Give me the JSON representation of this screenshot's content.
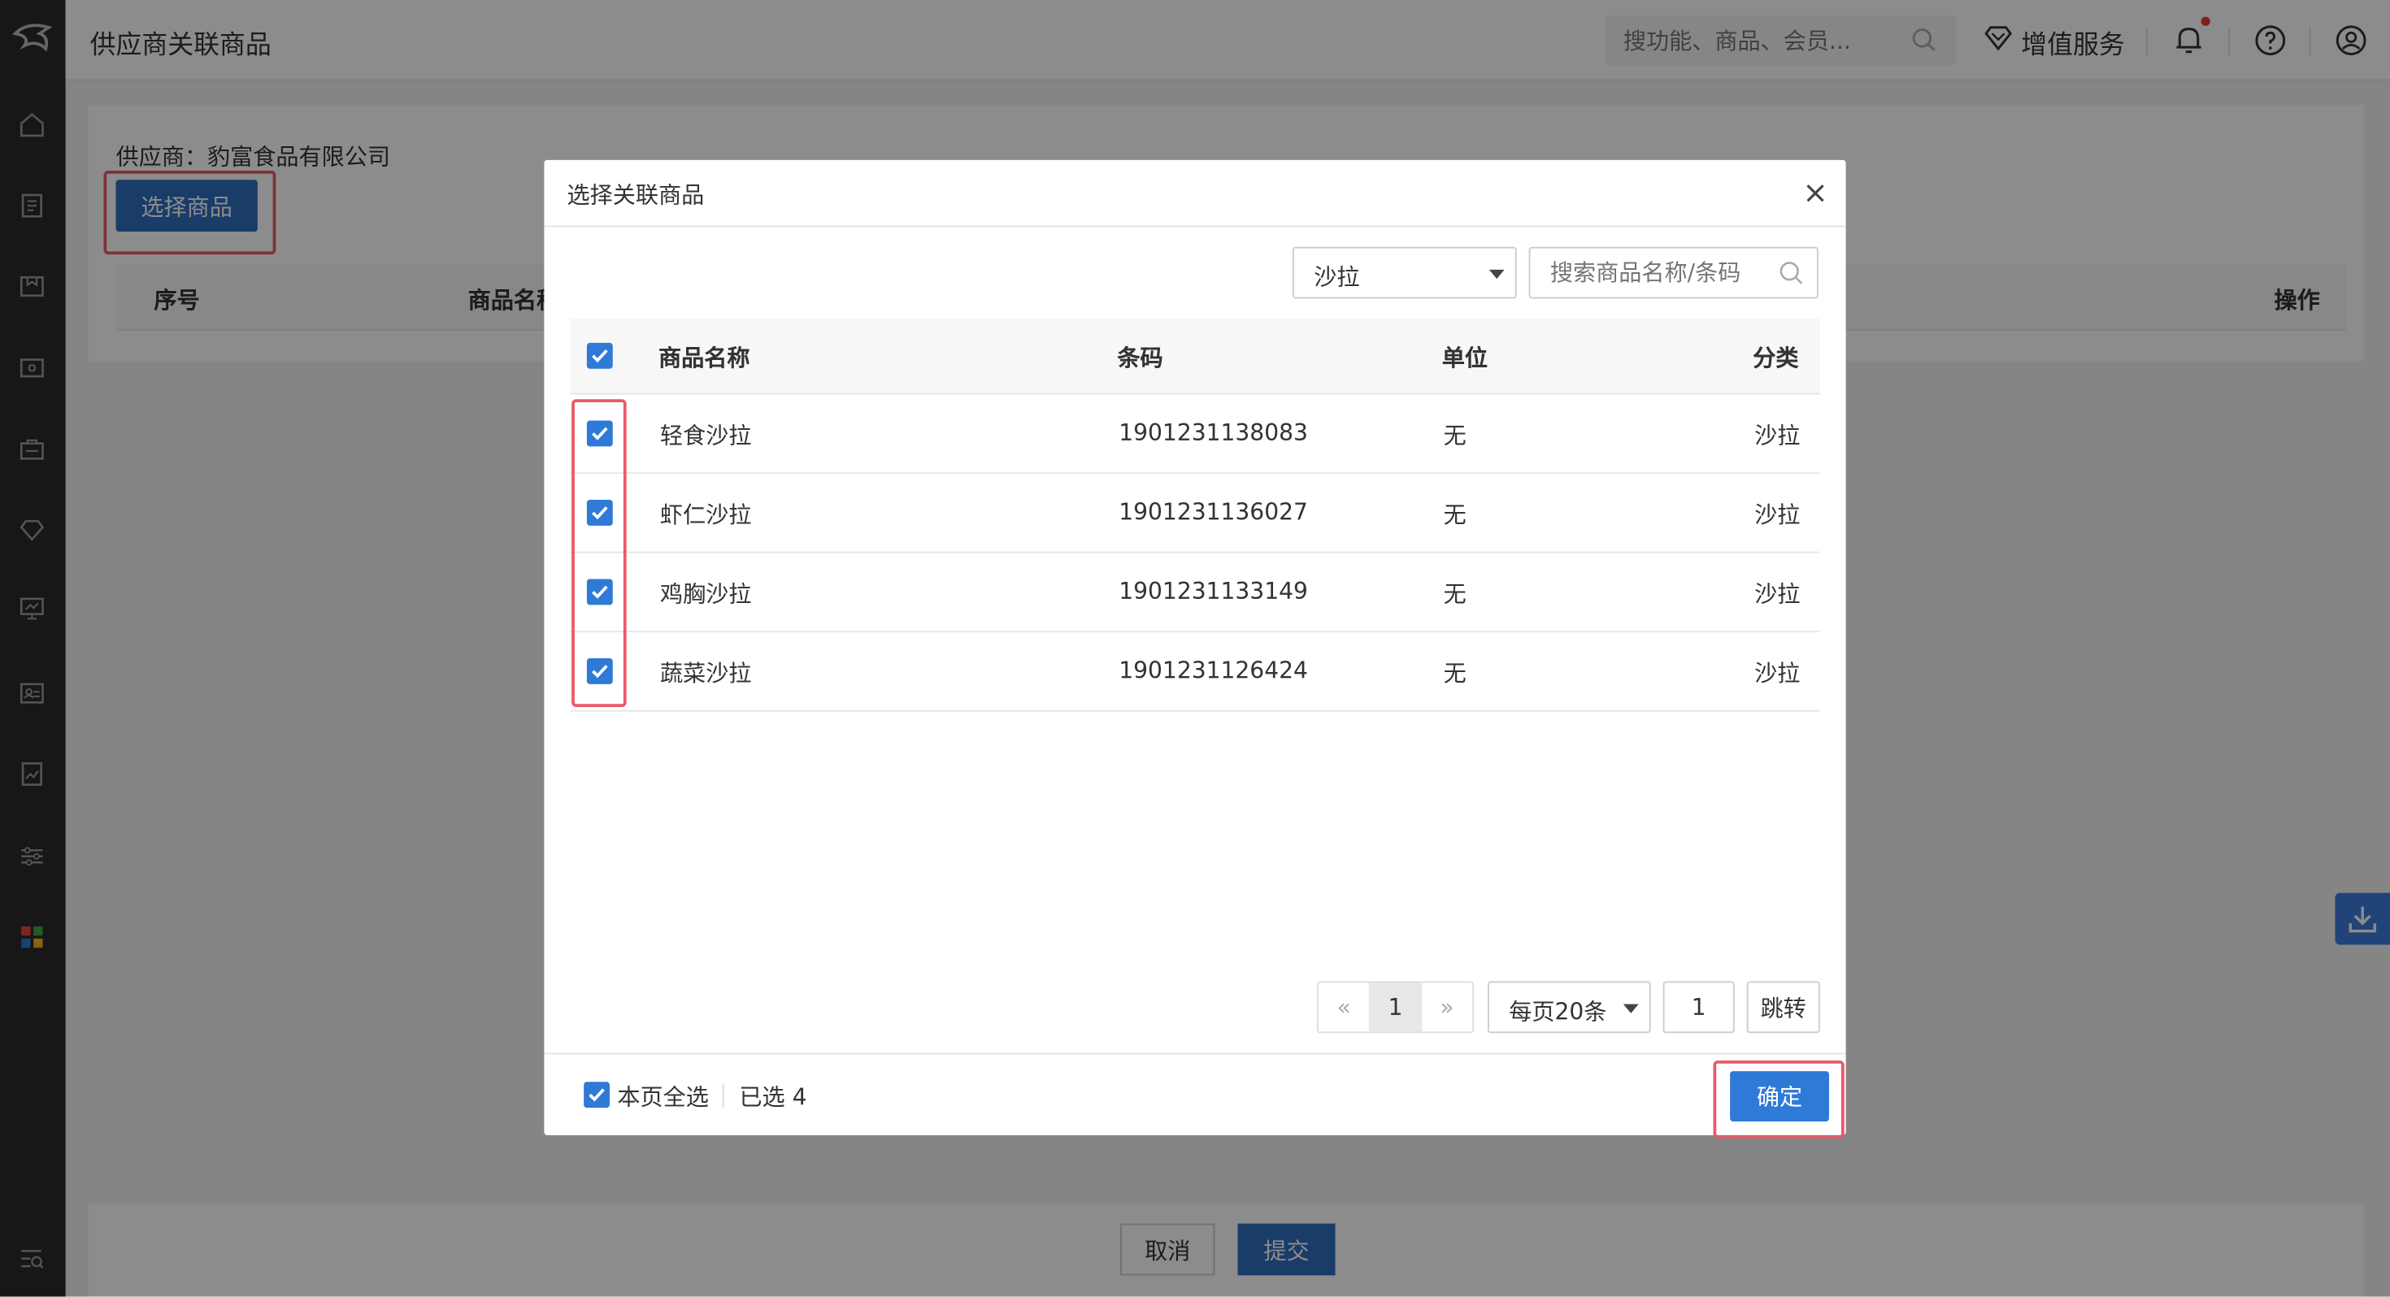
{
  "header": {
    "page_title": "供应商关联商品",
    "search_placeholder": "搜功能、商品、会员...",
    "value_added_label": "增值服务"
  },
  "page": {
    "supplier_label": "供应商：豹富食品有限公司",
    "select_goods_label": "选择商品",
    "columns": [
      "序号",
      "商品名称",
      "操作"
    ],
    "cancel_label": "取消",
    "submit_label": "提交"
  },
  "modal": {
    "title": "选择关联商品",
    "close_label": "×",
    "category_value": "沙拉",
    "search_placeholder": "搜索商品名称/条码",
    "columns": [
      "商品名称",
      "条码",
      "单位",
      "分类"
    ],
    "rows": [
      {
        "name": "轻食沙拉",
        "barcode": "1901231138083",
        "unit": "无",
        "category": "沙拉",
        "checked": true
      },
      {
        "name": "虾仁沙拉",
        "barcode": "1901231136027",
        "unit": "无",
        "category": "沙拉",
        "checked": true
      },
      {
        "name": "鸡胸沙拉",
        "barcode": "1901231133149",
        "unit": "无",
        "category": "沙拉",
        "checked": true
      },
      {
        "name": "蔬菜沙拉",
        "barcode": "1901231126424",
        "unit": "无",
        "category": "沙拉",
        "checked": true
      }
    ],
    "pager": {
      "prev": "«",
      "current": "1",
      "next": "»",
      "per_page": "每页20条",
      "jump_value": "1",
      "jump_label": "跳转"
    },
    "footer": {
      "select_all_label": "本页全选",
      "selected_count": "已选 4",
      "confirm_label": "确定"
    }
  },
  "colors": {
    "primary": "#2f7ad7",
    "highlight": "#e95a67",
    "sidebar": "#2b2b2b"
  }
}
